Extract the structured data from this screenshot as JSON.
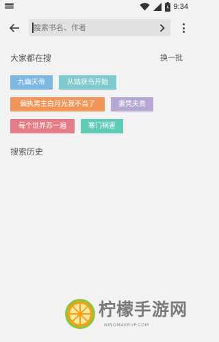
{
  "status_bar": {
    "time": "9:34",
    "icons": [
      "notification-icon",
      "wifi-icon",
      "signal-icon",
      "battery-icon"
    ]
  },
  "toolbar": {
    "back_icon": "arrow-left-icon",
    "search_placeholder": "搜索书名、作者",
    "go_icon": "chevron-right-icon",
    "more_icon": "more-vertical-icon"
  },
  "hot_search": {
    "title": "大家都在搜",
    "refresh_label": "换一批",
    "tags": [
      {
        "label": "九幽天帝",
        "color": "#7fb7e3"
      },
      {
        "label": "从姑获鸟开始",
        "color": "#7fc9cf"
      },
      {
        "label": "偏执男主白月光我不当了",
        "color": "#f0955a"
      },
      {
        "label": "妻凭夫贵",
        "color": "#b7a7d3"
      },
      {
        "label": "每个世界苏一遍",
        "color": "#e47d85"
      },
      {
        "label": "寒门祸害",
        "color": "#5fcab5"
      }
    ]
  },
  "history": {
    "title": "搜索历史"
  },
  "watermark": {
    "title": "柠檬手游网",
    "url": "NINGMAKEUP.COM"
  }
}
